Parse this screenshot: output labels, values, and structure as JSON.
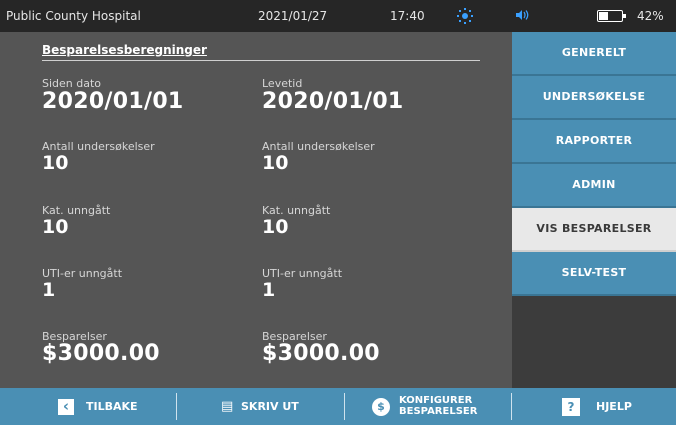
{
  "status_bar": {
    "facility": "Public County Hospital",
    "date": "2021/01/27",
    "time": "17:40",
    "brightness_icon": "sun-icon",
    "volume_icon": "speaker-icon",
    "battery_percent": "42%",
    "battery_level": 0.42,
    "accent_color": "#3aa0ff"
  },
  "content": {
    "section_title": "Besparelsesberegninger",
    "columns": [
      {
        "date_label": "Siden dato",
        "date_value": "2020/01/01",
        "exams_label": "Antall undersøkelser",
        "exams_value": "10",
        "cath_label": "Kat. unngått",
        "cath_value": "10",
        "uti_label": "UTI-er unngått",
        "uti_value": "1",
        "savings_label": "Besparelser",
        "savings_value": "$3000.00"
      },
      {
        "date_label": "Levetid",
        "date_value": "2020/01/01",
        "exams_label": "Antall undersøkelser",
        "exams_value": "10",
        "cath_label": "Kat. unngått",
        "cath_value": "10",
        "uti_label": "UTI-er unngått",
        "uti_value": "1",
        "savings_label": "Besparelser",
        "savings_value": "$3000.00"
      }
    ]
  },
  "menu": {
    "items": [
      {
        "label": "GENERELT",
        "active": false
      },
      {
        "label": "UNDERSØKELSE",
        "active": false
      },
      {
        "label": "RAPPORTER",
        "active": false
      },
      {
        "label": "ADMIN",
        "active": false
      },
      {
        "label": "VIS BESPARELSER",
        "active": true
      },
      {
        "label": "SELV-TEST",
        "active": false
      }
    ],
    "accent_color": "#4a8fb4"
  },
  "bottom_bar": {
    "back_label": "TILBAKE",
    "back_icon": "chevron-left-icon",
    "print_label": "SKRIV UT",
    "print_icon": "document-icon",
    "configure_line1": "KONFIGURER",
    "configure_line2": "BESPARELSER",
    "configure_icon": "dollar-icon",
    "configure_icon_glyph": "$",
    "help_label": "HJELP",
    "help_icon": "help-icon",
    "help_glyph": "?",
    "back_glyph": "‹",
    "print_glyph": "▤"
  }
}
